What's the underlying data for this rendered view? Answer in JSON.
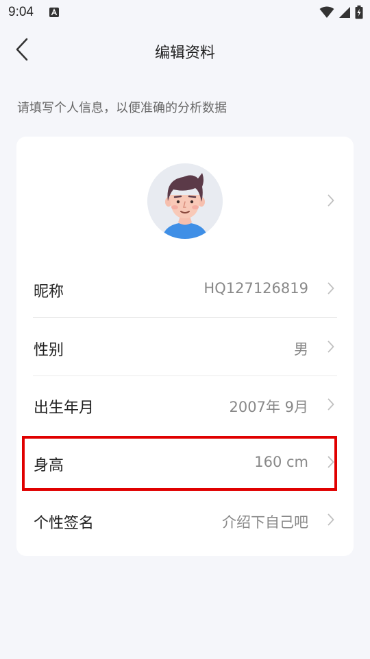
{
  "status_bar": {
    "time": "9:04",
    "icons": [
      "a-badge-icon",
      "wifi-icon",
      "signal-icon",
      "battery-charging-icon"
    ]
  },
  "header": {
    "back_icon": "chevron-left-icon",
    "title": "编辑资料"
  },
  "hint": "请填写个人信息，以便准确的分析数据",
  "profile": {
    "avatar_icon": "cartoon-boy-avatar",
    "rows": [
      {
        "label": "昵称",
        "value": "HQ127126819"
      },
      {
        "label": "性别",
        "value": "男"
      },
      {
        "label": "出生年月",
        "value": "2007年 9月"
      },
      {
        "label": "身高",
        "value": "160 cm"
      },
      {
        "label": "个性签名",
        "value": "介绍下自己吧"
      }
    ]
  },
  "colors": {
    "background": "#f5f6fa",
    "card": "#ffffff",
    "highlight": "#e00000",
    "value_text": "#888888",
    "chevron": "#c0c0c0"
  }
}
